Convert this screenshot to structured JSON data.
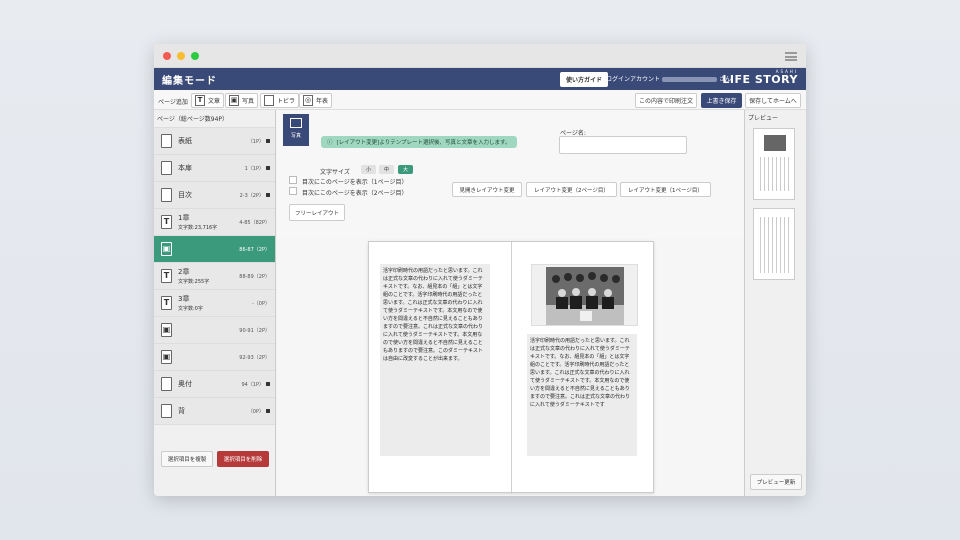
{
  "app": {
    "title": "編集モード",
    "guide_button": "使い方ガイド",
    "account_prefix": "ログインアカウント",
    "account_suffix": "さん",
    "logo_small": "ASAHI",
    "logo_big": "LIFE STORY"
  },
  "toolbar": {
    "page_add_label": "ページ追加",
    "buttons": [
      {
        "icon": "T",
        "label": "文章"
      },
      {
        "icon": "▣",
        "label": "写真"
      },
      {
        "icon": "",
        "label": "トビラ"
      },
      {
        "icon": "◎",
        "label": "年表"
      }
    ],
    "print_order": "この内容で印刷注文",
    "overwrite_save": "上書き保存",
    "save_home": "保存してホームへ"
  },
  "sidebar": {
    "header": "ページ（総ページ数94P）",
    "items": [
      {
        "icon": "",
        "name": "表紙",
        "sub": "",
        "range": "（1P）",
        "locked": true
      },
      {
        "icon": "",
        "name": "本扉",
        "sub": "",
        "range": "1（1P）",
        "locked": true
      },
      {
        "icon": "",
        "name": "目次",
        "sub": "",
        "range": "2-3（2P）",
        "locked": true
      },
      {
        "icon": "T",
        "name": "1章",
        "sub": "文字数:23,716字",
        "range": "4-85（82P）",
        "locked": false
      },
      {
        "icon": "▣",
        "name": "",
        "sub": "",
        "range": "86-87（2P）",
        "locked": false,
        "active": true
      },
      {
        "icon": "T",
        "name": "2章",
        "sub": "文字数:255字",
        "range": "88-89（2P）",
        "locked": false
      },
      {
        "icon": "T",
        "name": "3章",
        "sub": "文字数:0字",
        "range": "-（0P）",
        "locked": false
      },
      {
        "icon": "▣",
        "name": "",
        "sub": "",
        "range": "90-91（2P）",
        "locked": false
      },
      {
        "icon": "▣",
        "name": "",
        "sub": "",
        "range": "92-93（2P）",
        "locked": false
      },
      {
        "icon": "",
        "name": "奥付",
        "sub": "",
        "range": "94（1P）",
        "locked": true
      },
      {
        "icon": "",
        "name": "背",
        "sub": "",
        "range": "（0P）",
        "locked": true
      }
    ],
    "duplicate_button": "選択項目を複製",
    "delete_button": "選択項目を削除"
  },
  "editor": {
    "page_type_label": "写真",
    "notice": "[レイアウト変更]よりテンプレート選択後、写真と文章を入力します。",
    "page_name_label": "ページ名:",
    "page_name_value": "",
    "font_size_label": "文字サイズ",
    "font_sizes": [
      "小",
      "中",
      "大"
    ],
    "font_size_selected": "大",
    "toc_1": "目次にこのページを表示（1ページ目）",
    "toc_2": "目次にこのページを表示（2ページ目）",
    "layout_spread": "見開きレイアウト変更",
    "layout_p2": "レイアウト変更（2ページ目）",
    "layout_p1": "レイアウト変更（1ページ目）",
    "free_layout": "フリーレイアウト",
    "left_text": "活字印刷時代の用語だったと思います。これは正式な文章の代わりに入れて使うダミーテキストです。なお、組見本の「組」とは文字組のことです。活字印刷時代の用語だったと思います。これは正式な文章の代わりに入れて使うダミーテキストです。本文用なので使い方を間違えると不自然に見えることもありますので要注意。これは正式な文章の代わりに入れて使うダミーテキストです。本文用なので使い方を間違えると不自然に見えることもありますので要注意。このダミーテキストは自由に改変することが出来ます。",
    "right_text": "活字印刷時代の用語だったと思います。これは正式な文章の代わりに入れて使うダミーテキストです。なお、組見本の「組」とは文字組のことです。活字印刷時代の用語だったと思います。これは正式な文章の代わりに入れて使うダミーテキストです。本文用なので使い方を間違えると不自然に見えることもありますので要注意。これは正式な文章の代わりに入れて使うダミーテキストです"
  },
  "preview": {
    "header": "プレビュー",
    "update_button": "プレビュー更新"
  },
  "colors": {
    "appbar": "#3a4a78",
    "active": "#3c9a7c",
    "delete": "#b63a3a",
    "notice": "#9fd7c0"
  }
}
